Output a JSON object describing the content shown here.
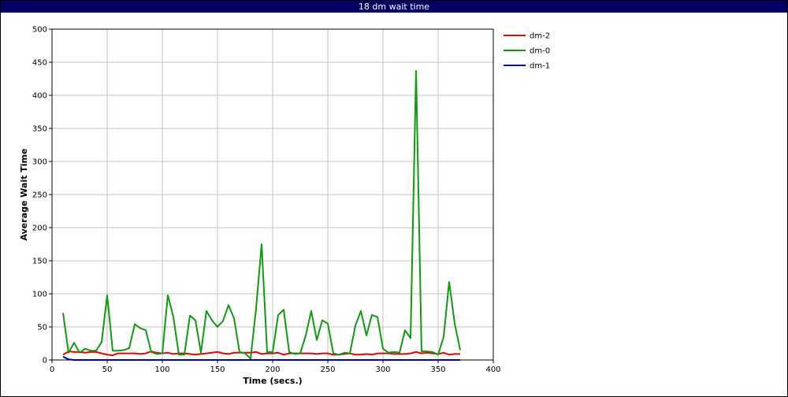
{
  "window": {
    "title": "18 dm wait time"
  },
  "colors": {
    "title_bar": "#000066",
    "dm-2": "#ee0000",
    "dm-0": "#119911",
    "dm-1": "#0000aa",
    "grid": "#c0c0c0"
  },
  "chart_data": {
    "type": "line",
    "title": "18 dm wait time",
    "xlabel": "Time (secs.)",
    "ylabel": "Average Wait Time",
    "xlim": [
      0,
      400
    ],
    "ylim": [
      0,
      500
    ],
    "xticks": [
      0,
      50,
      100,
      150,
      200,
      250,
      300,
      350,
      400
    ],
    "yticks": [
      0,
      50,
      100,
      150,
      200,
      250,
      300,
      350,
      400,
      450,
      500
    ],
    "grid": true,
    "legend_position": "top-right outside plot",
    "x": [
      10,
      15,
      20,
      25,
      30,
      35,
      40,
      45,
      50,
      55,
      60,
      65,
      70,
      75,
      80,
      85,
      90,
      95,
      100,
      105,
      110,
      115,
      120,
      125,
      130,
      135,
      140,
      145,
      150,
      155,
      160,
      165,
      170,
      175,
      180,
      185,
      190,
      195,
      200,
      205,
      210,
      215,
      220,
      225,
      230,
      235,
      240,
      245,
      250,
      255,
      260,
      265,
      270,
      275,
      280,
      285,
      290,
      295,
      300,
      305,
      310,
      315,
      320,
      325,
      330,
      335,
      340,
      345,
      350,
      355,
      360,
      365,
      370
    ],
    "series": [
      {
        "name": "dm-2",
        "color": "#ee0000",
        "values": [
          8,
          13,
          12,
          12,
          11,
          12,
          12,
          10,
          8,
          7,
          10,
          10,
          10,
          10,
          9,
          10,
          13,
          11,
          10,
          11,
          9,
          10,
          10,
          9,
          8,
          9,
          10,
          11,
          12,
          10,
          9,
          11,
          11,
          11,
          11,
          12,
          9,
          10,
          10,
          11,
          8,
          10,
          10,
          10,
          10,
          10,
          9,
          10,
          10,
          8,
          8,
          9,
          10,
          8,
          8,
          9,
          8,
          10,
          10,
          10,
          9,
          9,
          9,
          10,
          12,
          10,
          11,
          10,
          9,
          11,
          8,
          9,
          9
        ]
      },
      {
        "name": "dm-0",
        "color": "#119911",
        "values": [
          71,
          11,
          26,
          11,
          17,
          14,
          14,
          27,
          98,
          14,
          14,
          15,
          18,
          54,
          48,
          45,
          12,
          9,
          10,
          98,
          65,
          8,
          8,
          67,
          60,
          11,
          74,
          60,
          50,
          59,
          83,
          63,
          12,
          10,
          2,
          78,
          175,
          12,
          12,
          68,
          76,
          12,
          9,
          10,
          37,
          74,
          30,
          60,
          55,
          10,
          8,
          11,
          10,
          52,
          74,
          37,
          68,
          65,
          17,
          11,
          12,
          11,
          45,
          33,
          437,
          13,
          13,
          12,
          8,
          35,
          118,
          55,
          15
        ]
      },
      {
        "name": "dm-1",
        "color": "#0000aa",
        "values": [
          5,
          1,
          0,
          0,
          0,
          0,
          0,
          0,
          0,
          0,
          0,
          0,
          0,
          0,
          0,
          0,
          0,
          0,
          0,
          0,
          0,
          0,
          0,
          0,
          0,
          0,
          0,
          0,
          0,
          0,
          0,
          0,
          0,
          0,
          0,
          0,
          0,
          0,
          0,
          0,
          0,
          0,
          0,
          0,
          0,
          0,
          0,
          0,
          0,
          0,
          0,
          0,
          0,
          0,
          0,
          0,
          0,
          0,
          0,
          0,
          0,
          0,
          0,
          0,
          0,
          0,
          0,
          0,
          0,
          0,
          0,
          0,
          0
        ]
      }
    ]
  }
}
